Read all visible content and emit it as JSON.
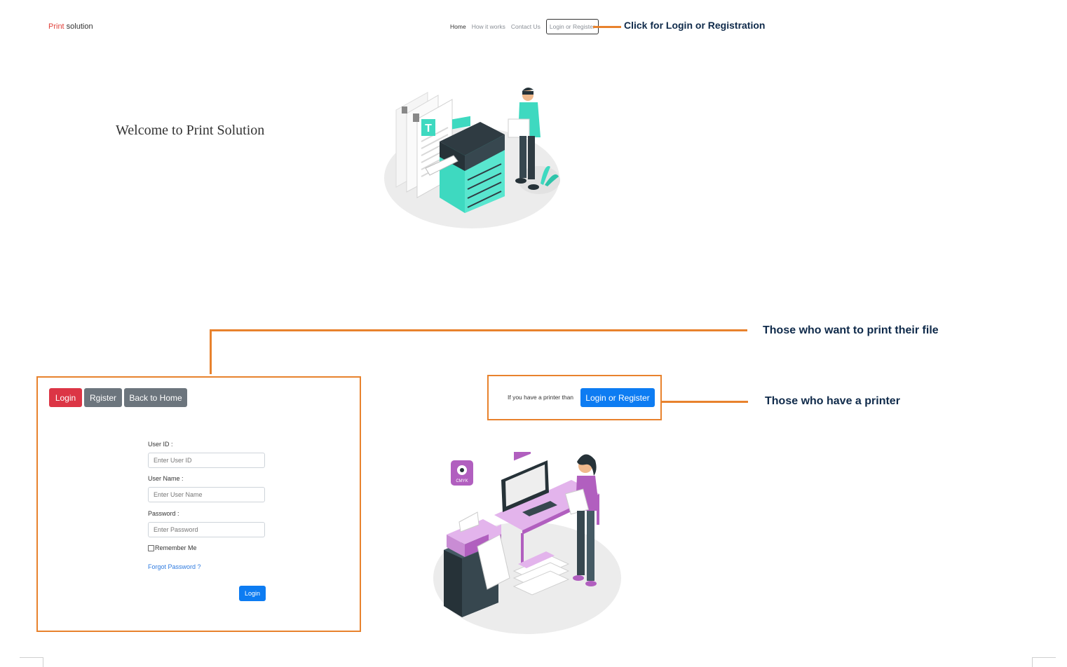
{
  "brand": {
    "part1": "Print",
    "part2": " solution"
  },
  "nav": {
    "items": [
      "Home",
      "How it works",
      "Contact Us"
    ],
    "login_register": "Login or Register"
  },
  "annotations": {
    "login_registration": "Click for Login or Registration",
    "print_file": "Those who want to print their file",
    "have_printer": "Those who have a printer"
  },
  "hero": {
    "title": "Welcome to Print Solution"
  },
  "login_panel": {
    "tabs": {
      "login": "Login",
      "register": "Rgister",
      "back_home": "Back to Home"
    },
    "user_id_label": "User ID :",
    "user_id_placeholder": "Enter User ID",
    "user_name_label": "User Name :",
    "user_name_placeholder": "Enter User Name",
    "password_label": "Password :",
    "password_placeholder": "Enter Password",
    "remember_me": "Remember Me",
    "forgot_password": "Forgot Password ?",
    "submit": "Login"
  },
  "printer_owner": {
    "text": "If you have a printer than",
    "button": "Login or Register"
  },
  "colors": {
    "accent_orange": "#e8822d",
    "brand_red": "#e0403a",
    "primary_blue": "#0d7cf2",
    "danger_red": "#dc3545",
    "secondary_gray": "#6c757d",
    "annotation_navy": "#0f2a4a",
    "illustration_teal": "#3ed9c0",
    "illustration_purple": "#b15fbf"
  },
  "icons": [
    "printer-illustration",
    "designer-illustration"
  ]
}
